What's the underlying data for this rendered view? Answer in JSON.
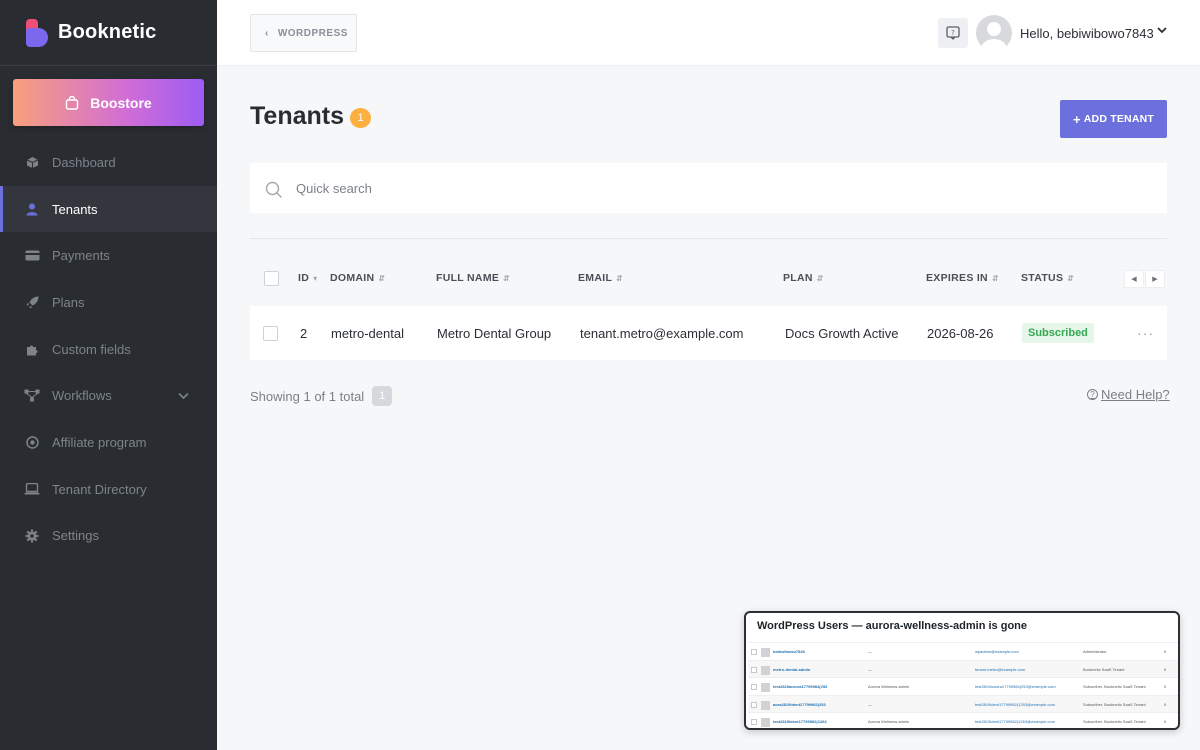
{
  "brand": {
    "name": "Booknetic"
  },
  "sidebar": {
    "boostore_label": "Boostore",
    "items": [
      {
        "label": "Dashboard",
        "icon": "dashboard-icon",
        "active": false
      },
      {
        "label": "Tenants",
        "icon": "user-icon",
        "active": true
      },
      {
        "label": "Payments",
        "icon": "credit-card-icon",
        "active": false
      },
      {
        "label": "Plans",
        "icon": "rocket-icon",
        "active": false
      },
      {
        "label": "Custom fields",
        "icon": "puzzle-icon",
        "active": false
      },
      {
        "label": "Workflows",
        "icon": "workflow-icon",
        "active": false
      },
      {
        "label": "Affiliate program",
        "icon": "target-icon",
        "active": false
      },
      {
        "label": "Tenant Directory",
        "icon": "laptop-icon",
        "active": false
      },
      {
        "label": "Settings",
        "icon": "gear-icon",
        "active": false
      }
    ]
  },
  "header": {
    "back_label": "WORDPRESS",
    "greeting": "Hello, bebiwibowo7843"
  },
  "main": {
    "title": "Tenants",
    "count": "1",
    "add_button_label": "ADD TENANT",
    "search_placeholder": "Quick search",
    "columns": [
      "ID",
      "DOMAIN",
      "FULL NAME",
      "EMAIL",
      "PLAN",
      "EXPIRES IN",
      "STATUS"
    ],
    "rows": [
      {
        "id": "2",
        "domain": "metro-dental",
        "full_name": "Metro Dental Group",
        "email": "tenant.metro@example.com",
        "plan": "Docs Growth Active",
        "expires_in": "2026-08-26",
        "status": "Subscribed"
      }
    ],
    "showing_text": "Showing 1 of 1 total",
    "current_page": "1",
    "need_help_label": "Need Help?"
  },
  "colors": {
    "sidebar_bg": "#292d32",
    "accent": "#6c70dc",
    "badge": "#fbb040",
    "status_green": "#34a853"
  },
  "thumbnail": {
    "title": "WordPress Users — aurora-wellness-admin is gone",
    "rows": [
      {
        "username": "bebiwibowo7843",
        "name": "—",
        "email": "wpadmin@example.com",
        "role": "Administrator",
        "posts": "0"
      },
      {
        "username": "metro-dental-admin",
        "name": "—",
        "email": "tenant.metro@example.com",
        "role": "Booknetic SaaS Tenant",
        "posts": "0"
      },
      {
        "username": "test2819aurora17799984(253",
        "name": "Aurora Wellness admin",
        "email": "test2819aurora17799984(253@example.com",
        "role": "Subscriber, Booknetic SaaS Tenant",
        "posts": "0"
      },
      {
        "username": "aora2819ident17799982(253",
        "name": "—",
        "email": "test2819ident17799982(1253@example.com",
        "role": "Subscriber, Booknetic SaaS Tenant",
        "posts": "0"
      },
      {
        "username": "test2819ident17799982(1263",
        "name": "Aurora Wellness admin",
        "email": "test2819ident17799982(1263@example.com",
        "role": "Subscriber, Booknetic SaaS Tenant",
        "posts": "0"
      }
    ]
  }
}
